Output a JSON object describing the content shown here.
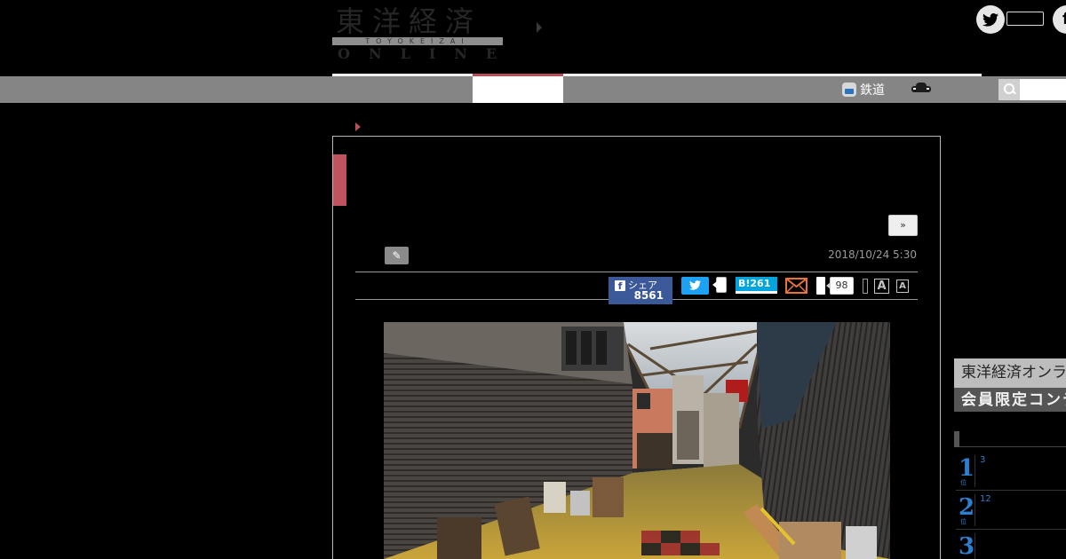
{
  "header": {
    "logo_main": "東洋経済",
    "logo_band": "TOYOKEIZAI",
    "logo_online": "ONLINE",
    "twitter_icon": "twitter-icon",
    "facebook_glyph": "f"
  },
  "nav": {
    "rail_label": "鉄道",
    "rail_icon": "train-icon",
    "car_icon": "car-icon",
    "search_icon": "search-icon"
  },
  "article": {
    "next_label": "»",
    "author_icon": "author-icon",
    "date": "2018/10/24 5:30",
    "share": {
      "facebook_label": "シェア",
      "facebook_count": "8561",
      "hatena_label": "B!",
      "hatena_count": "261",
      "comment_count": "98",
      "font_large": "A",
      "font_small": "A"
    }
  },
  "sidebar": {
    "banner_line1": "東洋経済オンライン",
    "banner_line2": "会員限定コンテンツ",
    "ranking": [
      {
        "rank": "1",
        "sub": "位",
        "value": "3"
      },
      {
        "rank": "2",
        "sub": "位",
        "value": "12"
      },
      {
        "rank": "3",
        "sub": "位",
        "value": ""
      }
    ]
  },
  "colors": {
    "accent_red": "#c0545e",
    "nav_gray": "#858585",
    "facebook_blue": "#3b5998",
    "twitter_blue": "#1da1f2",
    "hatena_blue": "#00a4de",
    "rank_blue": "#2a7fcf"
  }
}
